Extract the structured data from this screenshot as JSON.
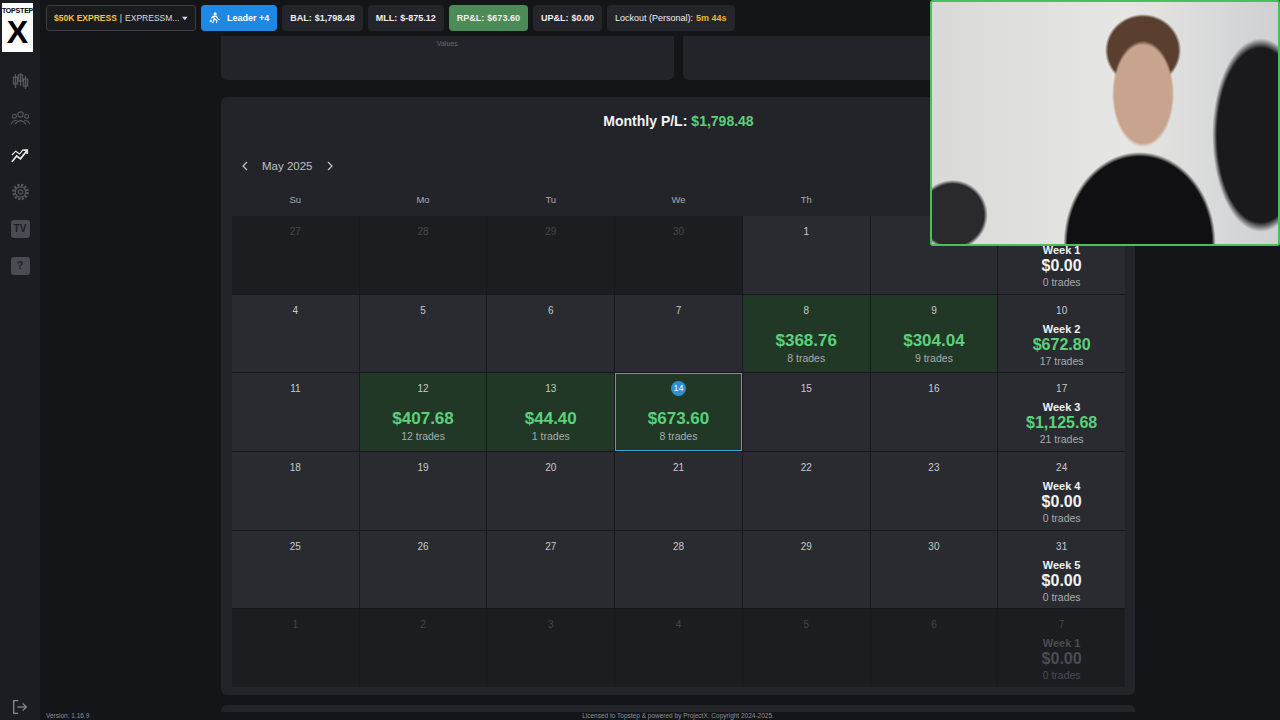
{
  "logo": {
    "top": "TOPSTEP",
    "mark": "X"
  },
  "sidebar": {
    "items": [
      {
        "kind": "chart",
        "selected": false,
        "label": ""
      },
      {
        "kind": "users",
        "selected": false,
        "label": ""
      },
      {
        "kind": "trend",
        "selected": true,
        "label": ""
      },
      {
        "kind": "gear",
        "selected": false,
        "label": ""
      },
      {
        "kind": "tv",
        "selected": false,
        "label": "TV"
      },
      {
        "kind": "help",
        "selected": false,
        "label": "?"
      }
    ],
    "version": "Version: 1.16.9"
  },
  "account": {
    "name": "$50K EXPRESS",
    "separator": "|",
    "sub": "EXPRESSM..."
  },
  "leader": {
    "label": "Leader +4"
  },
  "stats": [
    {
      "label": "BAL:",
      "value": "$1,798.48",
      "kind": "plain"
    },
    {
      "label": "MLL:",
      "value": "$-875.12",
      "kind": "plain"
    },
    {
      "label": "RP&L:",
      "value": "$673.60",
      "kind": "positive"
    },
    {
      "label": "UP&L:",
      "value": "$0.00",
      "kind": "plain"
    },
    {
      "label": "Lockout (Personal):",
      "value": "5m 44s",
      "kind": "timer"
    }
  ],
  "summary_card": {
    "caption": "Values"
  },
  "calendar": {
    "title": "Monthly P/L:",
    "total": "$1,798.48",
    "month": "May 2025",
    "weekdays": [
      "Su",
      "Mo",
      "Tu",
      "We",
      "Th"
    ],
    "weeks": [
      [
        {
          "day": "27",
          "kind": "day",
          "outside": true,
          "selected": false
        },
        {
          "day": "28",
          "kind": "day",
          "outside": true,
          "selected": false
        },
        {
          "day": "29",
          "kind": "day",
          "outside": true,
          "selected": false
        },
        {
          "day": "30",
          "kind": "day",
          "outside": true,
          "selected": false
        },
        {
          "day": "1",
          "kind": "day",
          "outside": false,
          "selected": false
        },
        {
          "day": "",
          "kind": "day",
          "outside": false,
          "selected": false
        },
        {
          "day": "",
          "kind": "week",
          "outside": false,
          "selected": false,
          "week": "Week 1",
          "pnl": "$0.00",
          "trades": "0 trades",
          "positive": false
        }
      ],
      [
        {
          "day": "4",
          "kind": "day",
          "outside": false,
          "selected": false
        },
        {
          "day": "5",
          "kind": "day",
          "outside": false,
          "selected": false
        },
        {
          "day": "6",
          "kind": "day",
          "outside": false,
          "selected": false
        },
        {
          "day": "7",
          "kind": "day",
          "outside": false,
          "selected": false
        },
        {
          "day": "8",
          "kind": "profit",
          "outside": false,
          "selected": false,
          "pnl": "$368.76",
          "trades": "8 trades"
        },
        {
          "day": "9",
          "kind": "profit",
          "outside": false,
          "selected": false,
          "pnl": "$304.04",
          "trades": "9 trades"
        },
        {
          "day": "10",
          "kind": "week",
          "outside": false,
          "selected": false,
          "week": "Week 2",
          "pnl": "$672.80",
          "trades": "17 trades",
          "positive": true
        }
      ],
      [
        {
          "day": "11",
          "kind": "day",
          "outside": false,
          "selected": false
        },
        {
          "day": "12",
          "kind": "profit",
          "outside": false,
          "selected": false,
          "pnl": "$407.68",
          "trades": "12 trades"
        },
        {
          "day": "13",
          "kind": "profit",
          "outside": false,
          "selected": false,
          "pnl": "$44.40",
          "trades": "1 trades"
        },
        {
          "day": "14",
          "kind": "profit",
          "outside": false,
          "selected": true,
          "pnl": "$673.60",
          "trades": "8 trades"
        },
        {
          "day": "15",
          "kind": "day",
          "outside": false,
          "selected": false
        },
        {
          "day": "16",
          "kind": "day",
          "outside": false,
          "selected": false
        },
        {
          "day": "17",
          "kind": "week",
          "outside": false,
          "selected": false,
          "week": "Week 3",
          "pnl": "$1,125.68",
          "trades": "21 trades",
          "positive": true
        }
      ],
      [
        {
          "day": "18",
          "kind": "day",
          "outside": false,
          "selected": false
        },
        {
          "day": "19",
          "kind": "day",
          "outside": false,
          "selected": false
        },
        {
          "day": "20",
          "kind": "day",
          "outside": false,
          "selected": false
        },
        {
          "day": "21",
          "kind": "day",
          "outside": false,
          "selected": false
        },
        {
          "day": "22",
          "kind": "day",
          "outside": false,
          "selected": false
        },
        {
          "day": "23",
          "kind": "day",
          "outside": false,
          "selected": false
        },
        {
          "day": "24",
          "kind": "week",
          "outside": false,
          "selected": false,
          "week": "Week 4",
          "pnl": "$0.00",
          "trades": "0 trades",
          "positive": false
        }
      ],
      [
        {
          "day": "25",
          "kind": "day",
          "outside": false,
          "selected": false
        },
        {
          "day": "26",
          "kind": "day",
          "outside": false,
          "selected": false
        },
        {
          "day": "27",
          "kind": "day",
          "outside": false,
          "selected": false
        },
        {
          "day": "28",
          "kind": "day",
          "outside": false,
          "selected": false
        },
        {
          "day": "29",
          "kind": "day",
          "outside": false,
          "selected": false
        },
        {
          "day": "30",
          "kind": "day",
          "outside": false,
          "selected": false
        },
        {
          "day": "31",
          "kind": "week",
          "outside": false,
          "selected": false,
          "week": "Week 5",
          "pnl": "$0.00",
          "trades": "0 trades",
          "positive": false
        }
      ],
      [
        {
          "day": "1",
          "kind": "day",
          "outside": true,
          "selected": false
        },
        {
          "day": "2",
          "kind": "day",
          "outside": true,
          "selected": false
        },
        {
          "day": "3",
          "kind": "day",
          "outside": true,
          "selected": false
        },
        {
          "day": "4",
          "kind": "day",
          "outside": true,
          "selected": false
        },
        {
          "day": "5",
          "kind": "day",
          "outside": true,
          "selected": false
        },
        {
          "day": "6",
          "kind": "day",
          "outside": true,
          "selected": false
        },
        {
          "day": "7",
          "kind": "week",
          "outside": true,
          "selected": false,
          "week": "Week 1",
          "pnl": "$0.00",
          "trades": "0 trades",
          "positive": false
        }
      ]
    ]
  },
  "footer": "Licensed to Topstep & powered by ProjectX. Copyright 2024-2025."
}
